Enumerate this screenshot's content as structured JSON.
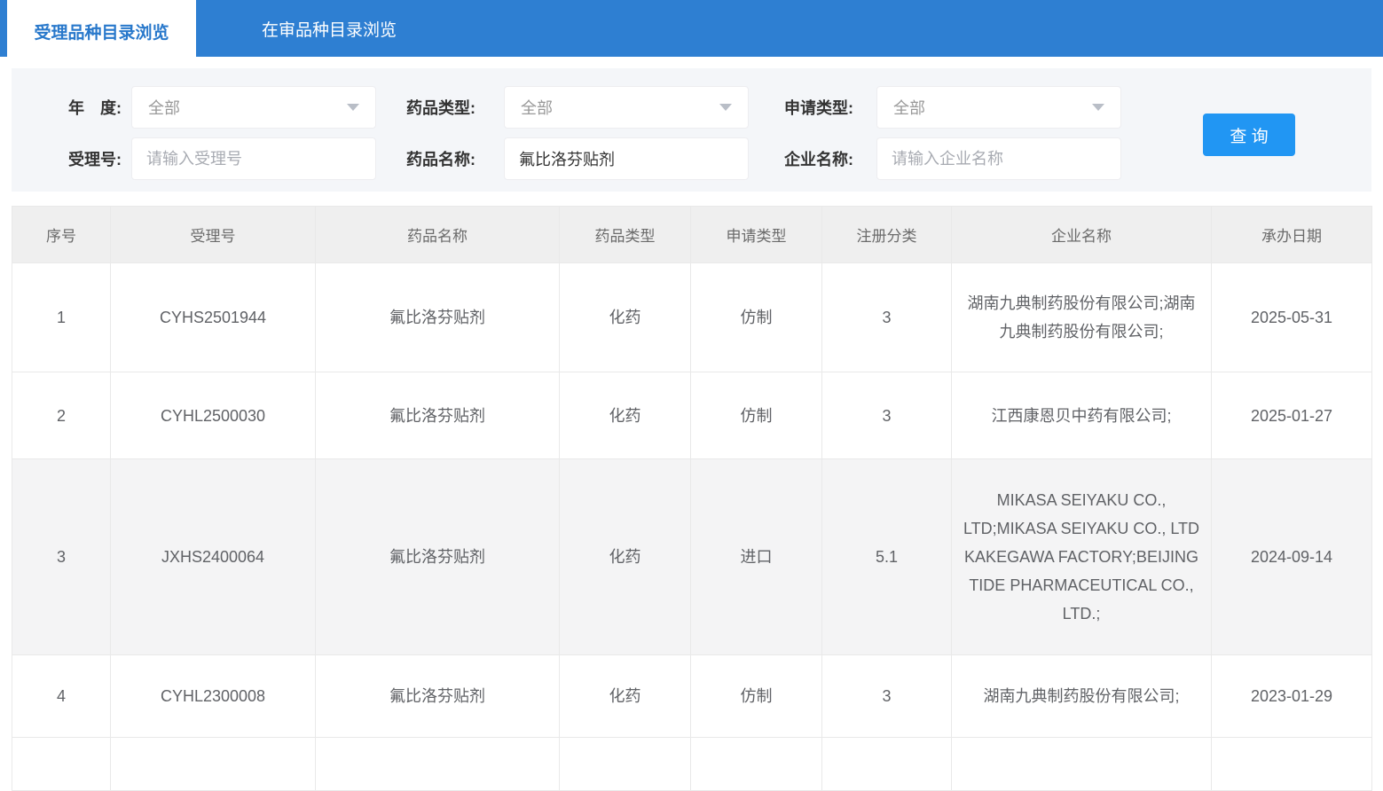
{
  "tabs": [
    {
      "label": "受理品种目录浏览"
    },
    {
      "label": "在审品种目录浏览"
    }
  ],
  "filters": {
    "year": {
      "label": "年　度:",
      "value": "全部"
    },
    "drug_type": {
      "label": "药品类型:",
      "value": "全部"
    },
    "apply_type": {
      "label": "申请类型:",
      "value": "全部"
    },
    "acceptance_no": {
      "label": "受理号:",
      "placeholder": "请输入受理号"
    },
    "drug_name": {
      "label": "药品名称:",
      "value": "氟比洛芬贴剂"
    },
    "company": {
      "label": "企业名称:",
      "placeholder": "请输入企业名称"
    },
    "search_label": "查 询"
  },
  "table": {
    "headers": [
      "序号",
      "受理号",
      "药品名称",
      "药品类型",
      "申请类型",
      "注册分类",
      "企业名称",
      "承办日期"
    ],
    "rows": [
      {
        "no": "1",
        "acceptance_no": "CYHS2501944",
        "drug_name": "氟比洛芬贴剂",
        "drug_type": "化药",
        "apply_type": "仿制",
        "reg_class": "3",
        "company": "湖南九典制药股份有限公司;湖南九典制药股份有限公司;",
        "date": "2025-05-31"
      },
      {
        "no": "2",
        "acceptance_no": "CYHL2500030",
        "drug_name": "氟比洛芬贴剂",
        "drug_type": "化药",
        "apply_type": "仿制",
        "reg_class": "3",
        "company": "江西康恩贝中药有限公司;",
        "date": "2025-01-27"
      },
      {
        "no": "3",
        "acceptance_no": "JXHS2400064",
        "drug_name": "氟比洛芬贴剂",
        "drug_type": "化药",
        "apply_type": "进口",
        "reg_class": "5.1",
        "company": "MIKASA SEIYAKU CO., LTD;MIKASA SEIYAKU CO., LTD KAKEGAWA FACTORY;BEIJING TIDE PHARMACEUTICAL CO., LTD.;",
        "date": "2024-09-14"
      },
      {
        "no": "4",
        "acceptance_no": "CYHL2300008",
        "drug_name": "氟比洛芬贴剂",
        "drug_type": "化药",
        "apply_type": "仿制",
        "reg_class": "3",
        "company": "湖南九典制药股份有限公司;",
        "date": "2023-01-29"
      }
    ]
  },
  "colors": {
    "tab_bar": "#2e7fd2",
    "active_tab_text": "#2878cb",
    "search_button": "#2196f3",
    "panel_bg": "#f4f6f9",
    "stripe_row": "#f4f4f5",
    "table_border": "#e9e9e9"
  }
}
